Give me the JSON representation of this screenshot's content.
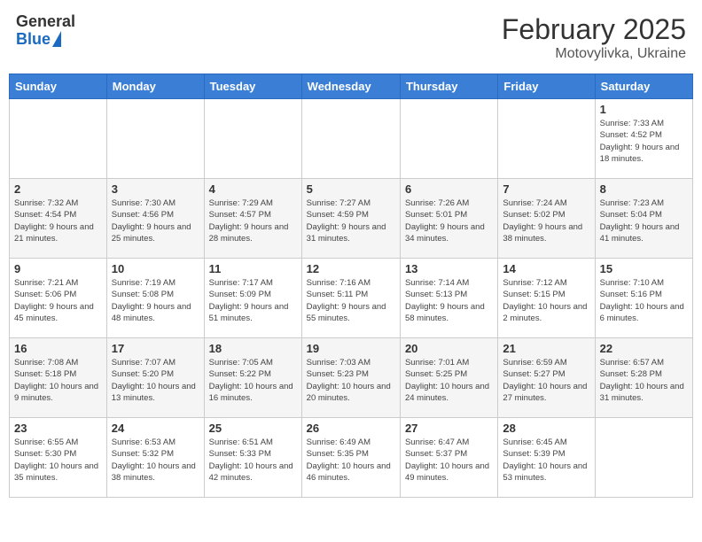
{
  "header": {
    "logo_general": "General",
    "logo_blue": "Blue",
    "month_title": "February 2025",
    "location": "Motovylivka, Ukraine"
  },
  "calendar": {
    "days_of_week": [
      "Sunday",
      "Monday",
      "Tuesday",
      "Wednesday",
      "Thursday",
      "Friday",
      "Saturday"
    ],
    "weeks": [
      [
        {
          "day": "",
          "info": ""
        },
        {
          "day": "",
          "info": ""
        },
        {
          "day": "",
          "info": ""
        },
        {
          "day": "",
          "info": ""
        },
        {
          "day": "",
          "info": ""
        },
        {
          "day": "",
          "info": ""
        },
        {
          "day": "1",
          "info": "Sunrise: 7:33 AM\nSunset: 4:52 PM\nDaylight: 9 hours and 18 minutes."
        }
      ],
      [
        {
          "day": "2",
          "info": "Sunrise: 7:32 AM\nSunset: 4:54 PM\nDaylight: 9 hours and 21 minutes."
        },
        {
          "day": "3",
          "info": "Sunrise: 7:30 AM\nSunset: 4:56 PM\nDaylight: 9 hours and 25 minutes."
        },
        {
          "day": "4",
          "info": "Sunrise: 7:29 AM\nSunset: 4:57 PM\nDaylight: 9 hours and 28 minutes."
        },
        {
          "day": "5",
          "info": "Sunrise: 7:27 AM\nSunset: 4:59 PM\nDaylight: 9 hours and 31 minutes."
        },
        {
          "day": "6",
          "info": "Sunrise: 7:26 AM\nSunset: 5:01 PM\nDaylight: 9 hours and 34 minutes."
        },
        {
          "day": "7",
          "info": "Sunrise: 7:24 AM\nSunset: 5:02 PM\nDaylight: 9 hours and 38 minutes."
        },
        {
          "day": "8",
          "info": "Sunrise: 7:23 AM\nSunset: 5:04 PM\nDaylight: 9 hours and 41 minutes."
        }
      ],
      [
        {
          "day": "9",
          "info": "Sunrise: 7:21 AM\nSunset: 5:06 PM\nDaylight: 9 hours and 45 minutes."
        },
        {
          "day": "10",
          "info": "Sunrise: 7:19 AM\nSunset: 5:08 PM\nDaylight: 9 hours and 48 minutes."
        },
        {
          "day": "11",
          "info": "Sunrise: 7:17 AM\nSunset: 5:09 PM\nDaylight: 9 hours and 51 minutes."
        },
        {
          "day": "12",
          "info": "Sunrise: 7:16 AM\nSunset: 5:11 PM\nDaylight: 9 hours and 55 minutes."
        },
        {
          "day": "13",
          "info": "Sunrise: 7:14 AM\nSunset: 5:13 PM\nDaylight: 9 hours and 58 minutes."
        },
        {
          "day": "14",
          "info": "Sunrise: 7:12 AM\nSunset: 5:15 PM\nDaylight: 10 hours and 2 minutes."
        },
        {
          "day": "15",
          "info": "Sunrise: 7:10 AM\nSunset: 5:16 PM\nDaylight: 10 hours and 6 minutes."
        }
      ],
      [
        {
          "day": "16",
          "info": "Sunrise: 7:08 AM\nSunset: 5:18 PM\nDaylight: 10 hours and 9 minutes."
        },
        {
          "day": "17",
          "info": "Sunrise: 7:07 AM\nSunset: 5:20 PM\nDaylight: 10 hours and 13 minutes."
        },
        {
          "day": "18",
          "info": "Sunrise: 7:05 AM\nSunset: 5:22 PM\nDaylight: 10 hours and 16 minutes."
        },
        {
          "day": "19",
          "info": "Sunrise: 7:03 AM\nSunset: 5:23 PM\nDaylight: 10 hours and 20 minutes."
        },
        {
          "day": "20",
          "info": "Sunrise: 7:01 AM\nSunset: 5:25 PM\nDaylight: 10 hours and 24 minutes."
        },
        {
          "day": "21",
          "info": "Sunrise: 6:59 AM\nSunset: 5:27 PM\nDaylight: 10 hours and 27 minutes."
        },
        {
          "day": "22",
          "info": "Sunrise: 6:57 AM\nSunset: 5:28 PM\nDaylight: 10 hours and 31 minutes."
        }
      ],
      [
        {
          "day": "23",
          "info": "Sunrise: 6:55 AM\nSunset: 5:30 PM\nDaylight: 10 hours and 35 minutes."
        },
        {
          "day": "24",
          "info": "Sunrise: 6:53 AM\nSunset: 5:32 PM\nDaylight: 10 hours and 38 minutes."
        },
        {
          "day": "25",
          "info": "Sunrise: 6:51 AM\nSunset: 5:33 PM\nDaylight: 10 hours and 42 minutes."
        },
        {
          "day": "26",
          "info": "Sunrise: 6:49 AM\nSunset: 5:35 PM\nDaylight: 10 hours and 46 minutes."
        },
        {
          "day": "27",
          "info": "Sunrise: 6:47 AM\nSunset: 5:37 PM\nDaylight: 10 hours and 49 minutes."
        },
        {
          "day": "28",
          "info": "Sunrise: 6:45 AM\nSunset: 5:39 PM\nDaylight: 10 hours and 53 minutes."
        },
        {
          "day": "",
          "info": ""
        }
      ]
    ]
  }
}
